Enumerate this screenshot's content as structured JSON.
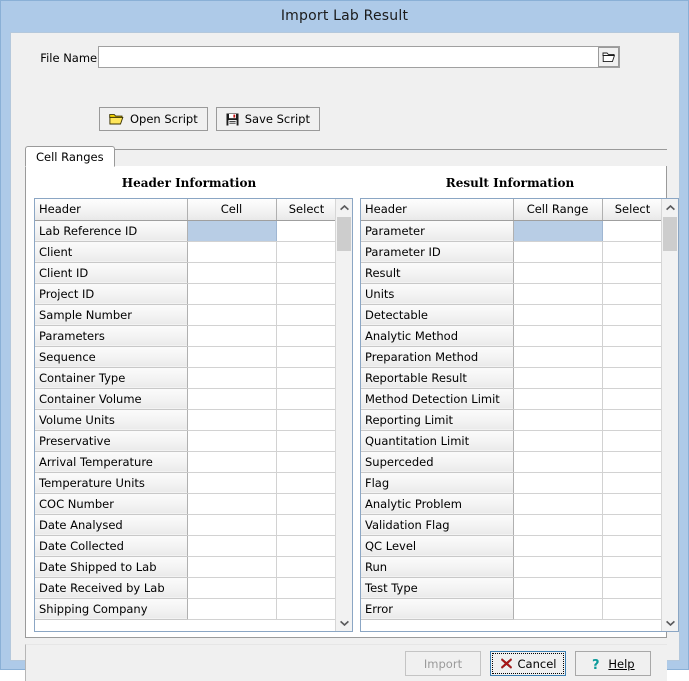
{
  "window": {
    "title": "Import Lab Result"
  },
  "file_section": {
    "label": "File Name:",
    "value": "",
    "placeholder": "",
    "browse_icon": "open-folder-icon"
  },
  "script_buttons": [
    {
      "label": "Open Script",
      "icon": "open-folder-icon",
      "name": "open-script-button"
    },
    {
      "label": "Save Script",
      "icon": "floppy-disk-icon",
      "name": "save-script-button"
    }
  ],
  "tabs": [
    {
      "label": "Cell Ranges",
      "selected": true
    }
  ],
  "header_section": {
    "title": "Header Information",
    "columns": [
      "Header",
      "Cell",
      "Select"
    ],
    "rows": [
      "Lab Reference ID",
      "Client",
      "Client ID",
      "Project ID",
      "Sample Number",
      "Parameters",
      "Sequence",
      "Container Type",
      "Container Volume",
      "Volume Units",
      "Preservative",
      "Arrival Temperature",
      "Temperature Units",
      "COC Number",
      "Date Analysed",
      "Date Collected",
      "Date Shipped to Lab",
      "Date Received by Lab",
      "Shipping Company"
    ],
    "selected_row_index": 0,
    "cell_values": [
      "",
      "",
      "",
      "",
      "",
      "",
      "",
      "",
      "",
      "",
      "",
      "",
      "",
      "",
      "",
      "",
      "",
      "",
      ""
    ],
    "select_values": [
      "",
      "",
      "",
      "",
      "",
      "",
      "",
      "",
      "",
      "",
      "",
      "",
      "",
      "",
      "",
      "",
      "",
      "",
      ""
    ],
    "scrollbar": {
      "up_icon": "chevron-up-icon",
      "down_icon": "chevron-down-icon"
    }
  },
  "result_section": {
    "title": "Result Information",
    "columns": [
      "Header",
      "Cell Range",
      "Select"
    ],
    "rows": [
      "Parameter",
      "Parameter ID",
      "Result",
      "Units",
      "Detectable",
      "Analytic Method",
      "Preparation Method",
      "Reportable Result",
      "Method Detection Limit",
      "Reporting Limit",
      "Quantitation Limit",
      "Superceded",
      "Flag",
      "Analytic Problem",
      "Validation Flag",
      "QC Level",
      "Run",
      "Test Type",
      "Error"
    ],
    "selected_row_index": 0,
    "cell_values": [
      "",
      "",
      "",
      "",
      "",
      "",
      "",
      "",
      "",
      "",
      "",
      "",
      "",
      "",
      "",
      "",
      "",
      "",
      ""
    ],
    "select_values": [
      "",
      "",
      "",
      "",
      "",
      "",
      "",
      "",
      "",
      "",
      "",
      "",
      "",
      "",
      "",
      "",
      "",
      "",
      ""
    ],
    "scrollbar": {
      "up_icon": "chevron-up-icon",
      "down_icon": "chevron-down-icon"
    }
  },
  "footer_buttons": [
    {
      "label": "Import",
      "name": "import-button",
      "state": "disabled",
      "icon": ""
    },
    {
      "label": "Cancel",
      "name": "cancel-button",
      "state": "focused",
      "icon": "red-x-icon"
    },
    {
      "label": "Help",
      "name": "help-button",
      "state": "normal",
      "icon": "question-mark-icon"
    }
  ],
  "colors": {
    "titlebar": "#aecae8",
    "client_bg": "#f0f0f0",
    "panel_bg": "#ffffff",
    "selected_cell": "#b8cde5",
    "grid_border": "#8ba6c4",
    "focus_border": "#3c7fb1",
    "cancel_icon": "#b01818",
    "help_icon": "#0b9a9a"
  }
}
